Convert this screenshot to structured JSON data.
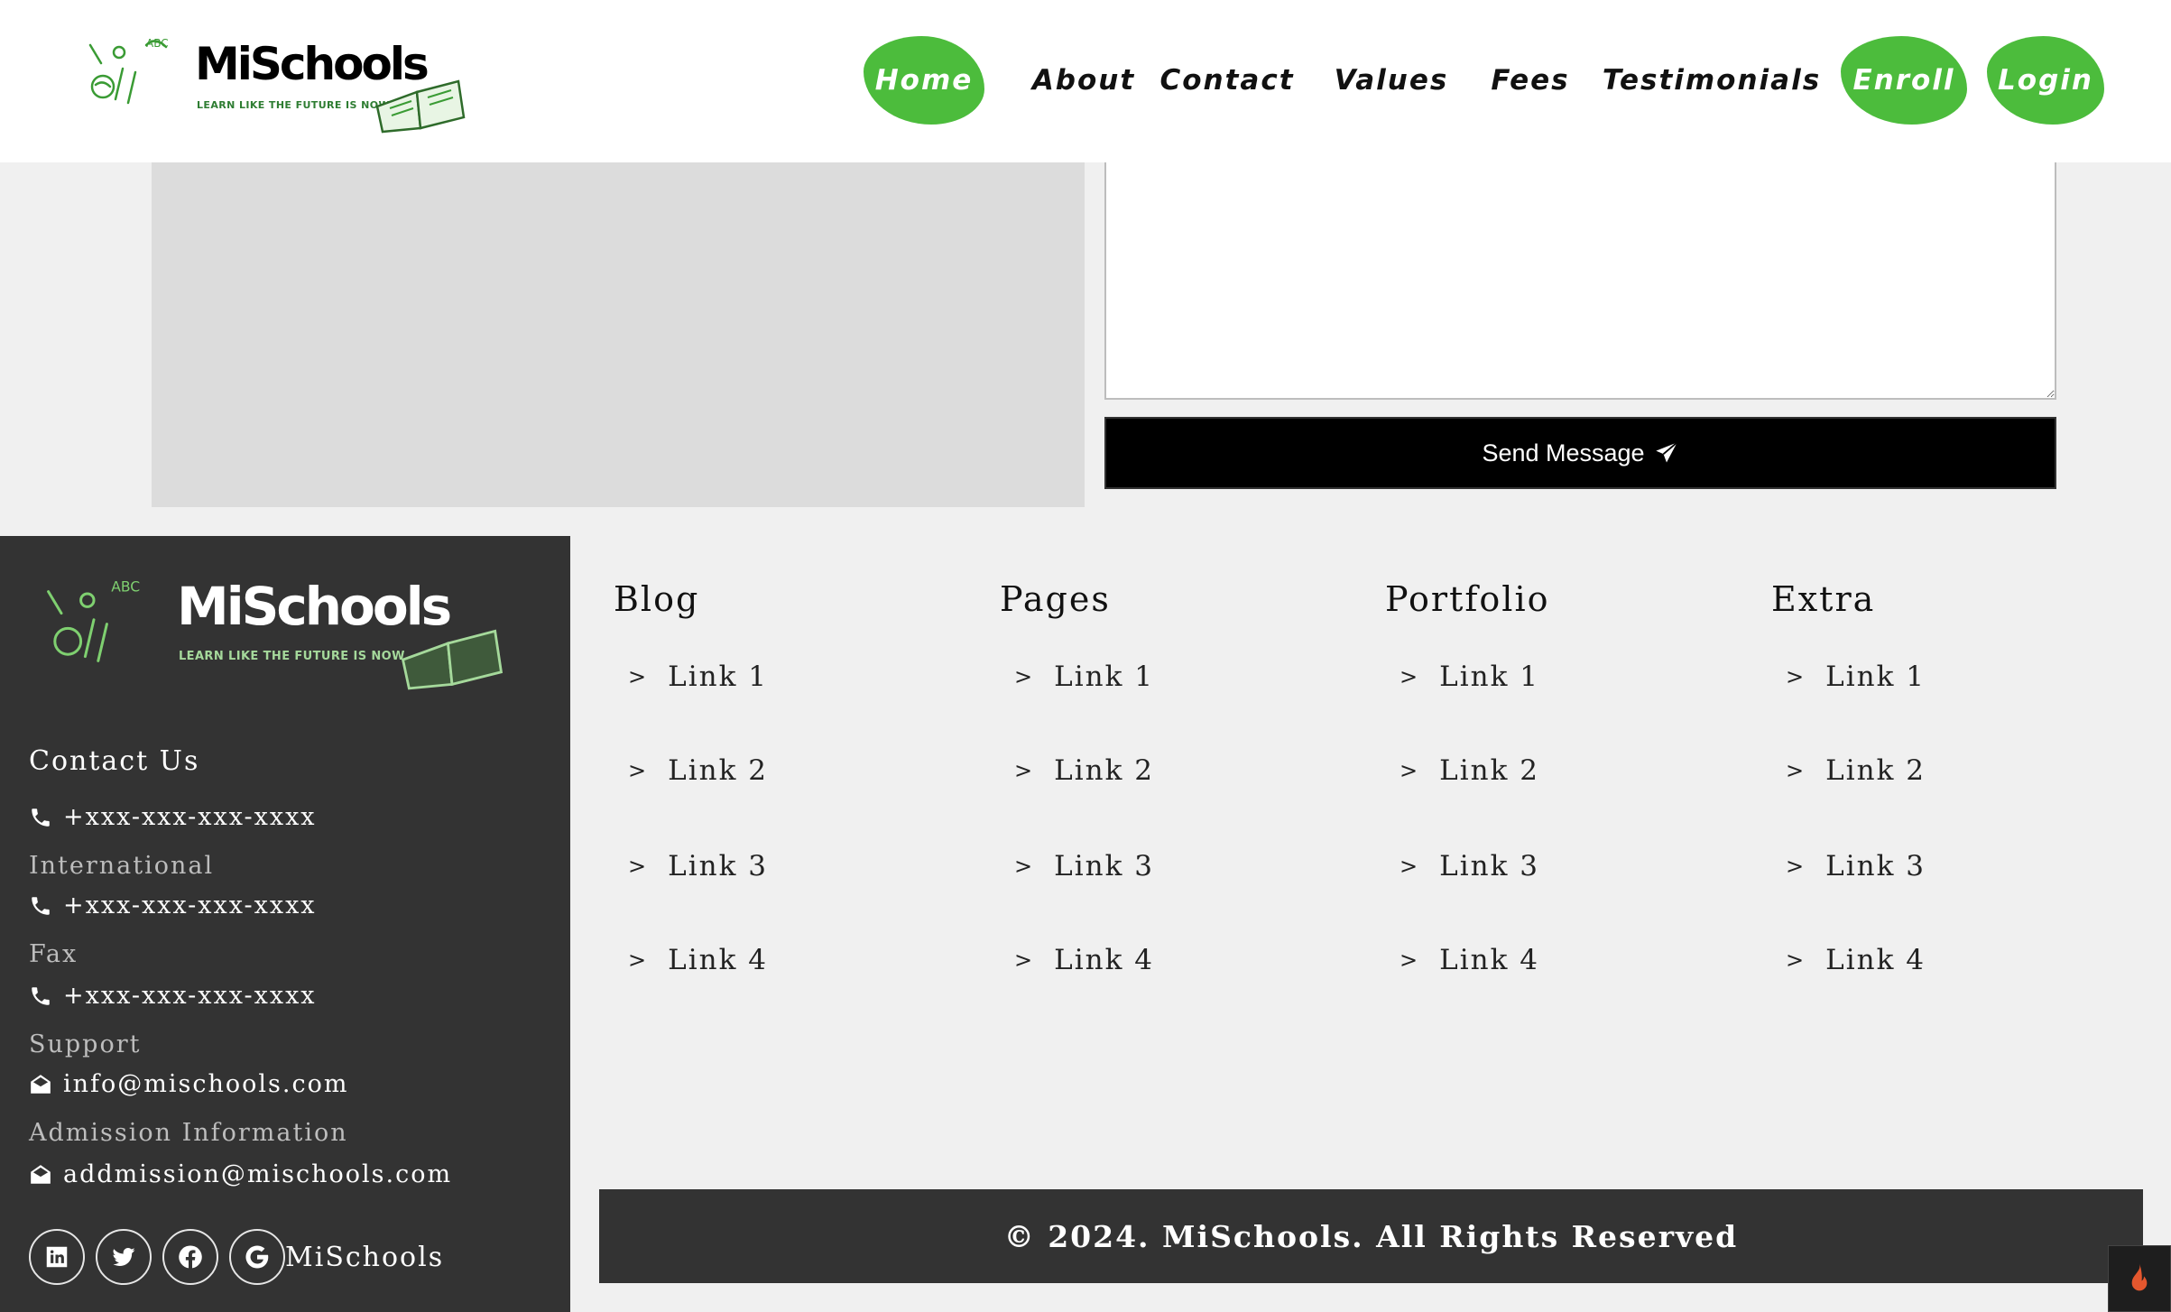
{
  "brand": {
    "name": "MiSchools",
    "tagline": "LEARN LIKE THE FUTURE IS NOW"
  },
  "nav": {
    "items": [
      {
        "label": "Home"
      },
      {
        "label": "About"
      },
      {
        "label": "Contact"
      },
      {
        "label": "Values"
      },
      {
        "label": "Fees"
      },
      {
        "label": "Testimonials"
      },
      {
        "label": "Enroll"
      },
      {
        "label": "Login"
      }
    ],
    "active": "Home",
    "accent_color": "#4cbc3c"
  },
  "form": {
    "message_value": "",
    "send_label": "Send Message",
    "send_icon": "paper-plane-icon"
  },
  "footer": {
    "contact": {
      "title": "Contact Us",
      "phone": "+xxx-xxx-xxx-xxxx",
      "international_label": "International",
      "international_phone": "+xxx-xxx-xxx-xxxx",
      "fax_label": "Fax",
      "fax_phone": "+xxx-xxx-xxx-xxxx",
      "support_label": "Support",
      "support_email": "info@mischools.com",
      "admission_label": "Admission Information",
      "admission_email": "addmission@mischools.com"
    },
    "socials": {
      "icons": [
        "linkedin-icon",
        "twitter-icon",
        "facebook-icon",
        "google-icon"
      ],
      "label": "MiSchools"
    },
    "columns": [
      {
        "title": "Blog",
        "links": [
          "Link 1",
          "Link 2",
          "Link 3",
          "Link 4"
        ]
      },
      {
        "title": "Pages",
        "links": [
          "Link 1",
          "Link 2",
          "Link 3",
          "Link 4"
        ]
      },
      {
        "title": "Portfolio",
        "links": [
          "Link 1",
          "Link 2",
          "Link 3",
          "Link 4"
        ]
      },
      {
        "title": "Extra",
        "links": [
          "Link 1",
          "Link 2",
          "Link 3",
          "Link 4"
        ]
      }
    ],
    "link_marker": ">",
    "copyright": "© 2024. MiSchools. All Rights Reserved",
    "panel_color": "#333333"
  }
}
